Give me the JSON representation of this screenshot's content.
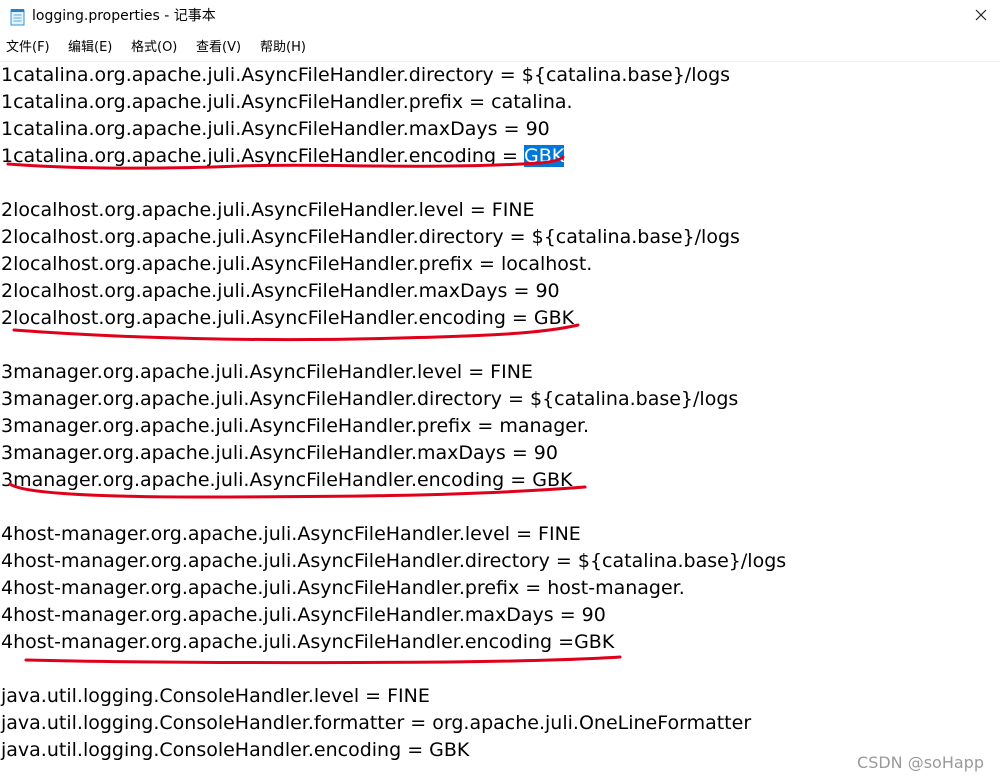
{
  "window": {
    "title": "logging.properties - 记事本",
    "close_glyph": "✕"
  },
  "menu": {
    "file": "文件(F)",
    "edit": "编辑(E)",
    "format": "格式(O)",
    "view": "查看(V)",
    "help": "帮助(H)"
  },
  "editor": {
    "lines": [
      "1catalina.org.apache.juli.AsyncFileHandler.directory = ${catalina.base}/logs",
      "1catalina.org.apache.juli.AsyncFileHandler.prefix = catalina.",
      "1catalina.org.apache.juli.AsyncFileHandler.maxDays = 90",
      "1catalina.org.apache.juli.AsyncFileHandler.encoding = ",
      "",
      "2localhost.org.apache.juli.AsyncFileHandler.level = FINE",
      "2localhost.org.apache.juli.AsyncFileHandler.directory = ${catalina.base}/logs",
      "2localhost.org.apache.juli.AsyncFileHandler.prefix = localhost.",
      "2localhost.org.apache.juli.AsyncFileHandler.maxDays = 90",
      "2localhost.org.apache.juli.AsyncFileHandler.encoding = GBK",
      "",
      "3manager.org.apache.juli.AsyncFileHandler.level = FINE",
      "3manager.org.apache.juli.AsyncFileHandler.directory = ${catalina.base}/logs",
      "3manager.org.apache.juli.AsyncFileHandler.prefix = manager.",
      "3manager.org.apache.juli.AsyncFileHandler.maxDays = 90",
      "3manager.org.apache.juli.AsyncFileHandler.encoding = GBK",
      "",
      "4host-manager.org.apache.juli.AsyncFileHandler.level = FINE",
      "4host-manager.org.apache.juli.AsyncFileHandler.directory = ${catalina.base}/logs",
      "4host-manager.org.apache.juli.AsyncFileHandler.prefix = host-manager.",
      "4host-manager.org.apache.juli.AsyncFileHandler.maxDays = 90",
      "4host-manager.org.apache.juli.AsyncFileHandler.encoding =GBK",
      "",
      "java.util.logging.ConsoleHandler.level = FINE",
      "java.util.logging.ConsoleHandler.formatter = org.apache.juli.OneLineFormatter",
      "java.util.logging.ConsoleHandler.encoding = GBK"
    ],
    "selected_text": "GBK",
    "selection_color": "#0078d7"
  },
  "annotation": {
    "underline_color": "#e0001b"
  },
  "watermark": "CSDN @soHapp"
}
